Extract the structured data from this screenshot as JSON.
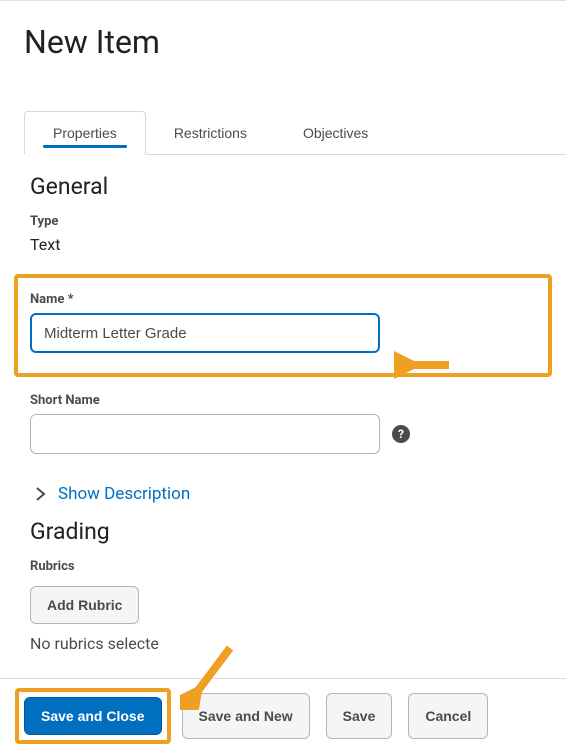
{
  "page": {
    "title": "New Item"
  },
  "tabs": {
    "properties": "Properties",
    "restrictions": "Restrictions",
    "objectives": "Objectives"
  },
  "general": {
    "heading": "General",
    "type_label": "Type",
    "type_value": "Text",
    "name_label": "Name *",
    "name_value": "Midterm Letter Grade",
    "short_name_label": "Short Name",
    "short_name_value": "",
    "show_description": "Show Description"
  },
  "grading": {
    "heading": "Grading",
    "rubrics_label": "Rubrics",
    "add_rubric": "Add Rubric",
    "no_rubrics": "No rubrics selecte"
  },
  "footer": {
    "save_and_close": "Save and Close",
    "save_and_new": "Save and New",
    "save": "Save",
    "cancel": "Cancel"
  }
}
